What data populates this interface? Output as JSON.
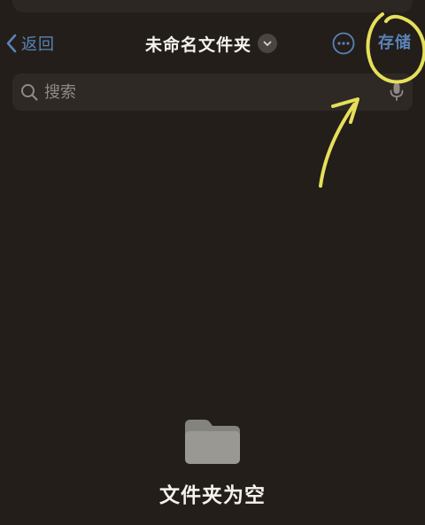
{
  "nav": {
    "back_label": "返回",
    "title": "未命名文件夹",
    "save_label": "存储"
  },
  "search": {
    "placeholder": "搜索",
    "value": ""
  },
  "empty_state": {
    "message": "文件夹为空"
  },
  "icons": {
    "back": "chevron-left-icon",
    "title_menu": "chevron-down-icon",
    "more": "ellipsis-circle-icon",
    "search": "magnifier-icon",
    "mic": "microphone-icon",
    "folder": "folder-icon"
  },
  "colors": {
    "background": "#231e1a",
    "accent": "#5a82b8",
    "search_field": "#2e2925",
    "folder": "#9a9893",
    "annotation": "#e6e05a"
  }
}
